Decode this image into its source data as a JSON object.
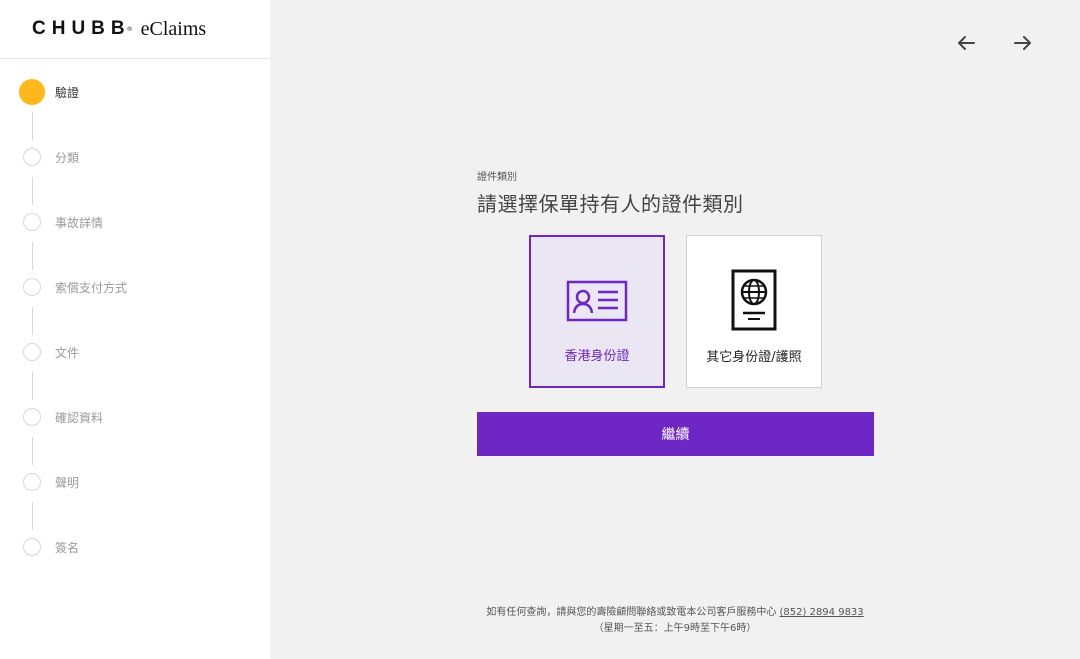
{
  "brand": {
    "logo": "CHUBB",
    "registered": "®",
    "product": "eClaims"
  },
  "steps": [
    {
      "label": "驗證",
      "state": "active"
    },
    {
      "label": "分類",
      "state": "pending"
    },
    {
      "label": "事故詳情",
      "state": "pending"
    },
    {
      "label": "索償支付方式",
      "state": "pending"
    },
    {
      "label": "文件",
      "state": "pending"
    },
    {
      "label": "確認資料",
      "state": "pending"
    },
    {
      "label": "聲明",
      "state": "pending"
    },
    {
      "label": "簽名",
      "state": "pending"
    }
  ],
  "nav": {
    "back_icon": "arrow-left-icon",
    "forward_icon": "arrow-right-icon"
  },
  "main": {
    "section_label": "證件類別",
    "title": "請選擇保單持有人的證件類別",
    "options": [
      {
        "label": "香港身份證",
        "icon": "id-card-icon",
        "selected": true
      },
      {
        "label": "其它身份證/護照",
        "icon": "passport-icon",
        "selected": false
      }
    ],
    "continue_label": "繼續"
  },
  "footer": {
    "line1_prefix": "如有任何查詢，請與您的壽險顧問聯絡或致電本公司客戶服務中心 ",
    "phone": "(852) 2894 9833",
    "line2": "（星期一至五：上午9時至下午6時）"
  },
  "colors": {
    "accent": "#6e27c5",
    "active_step": "#ffb81c",
    "background": "#f1f1f1"
  }
}
